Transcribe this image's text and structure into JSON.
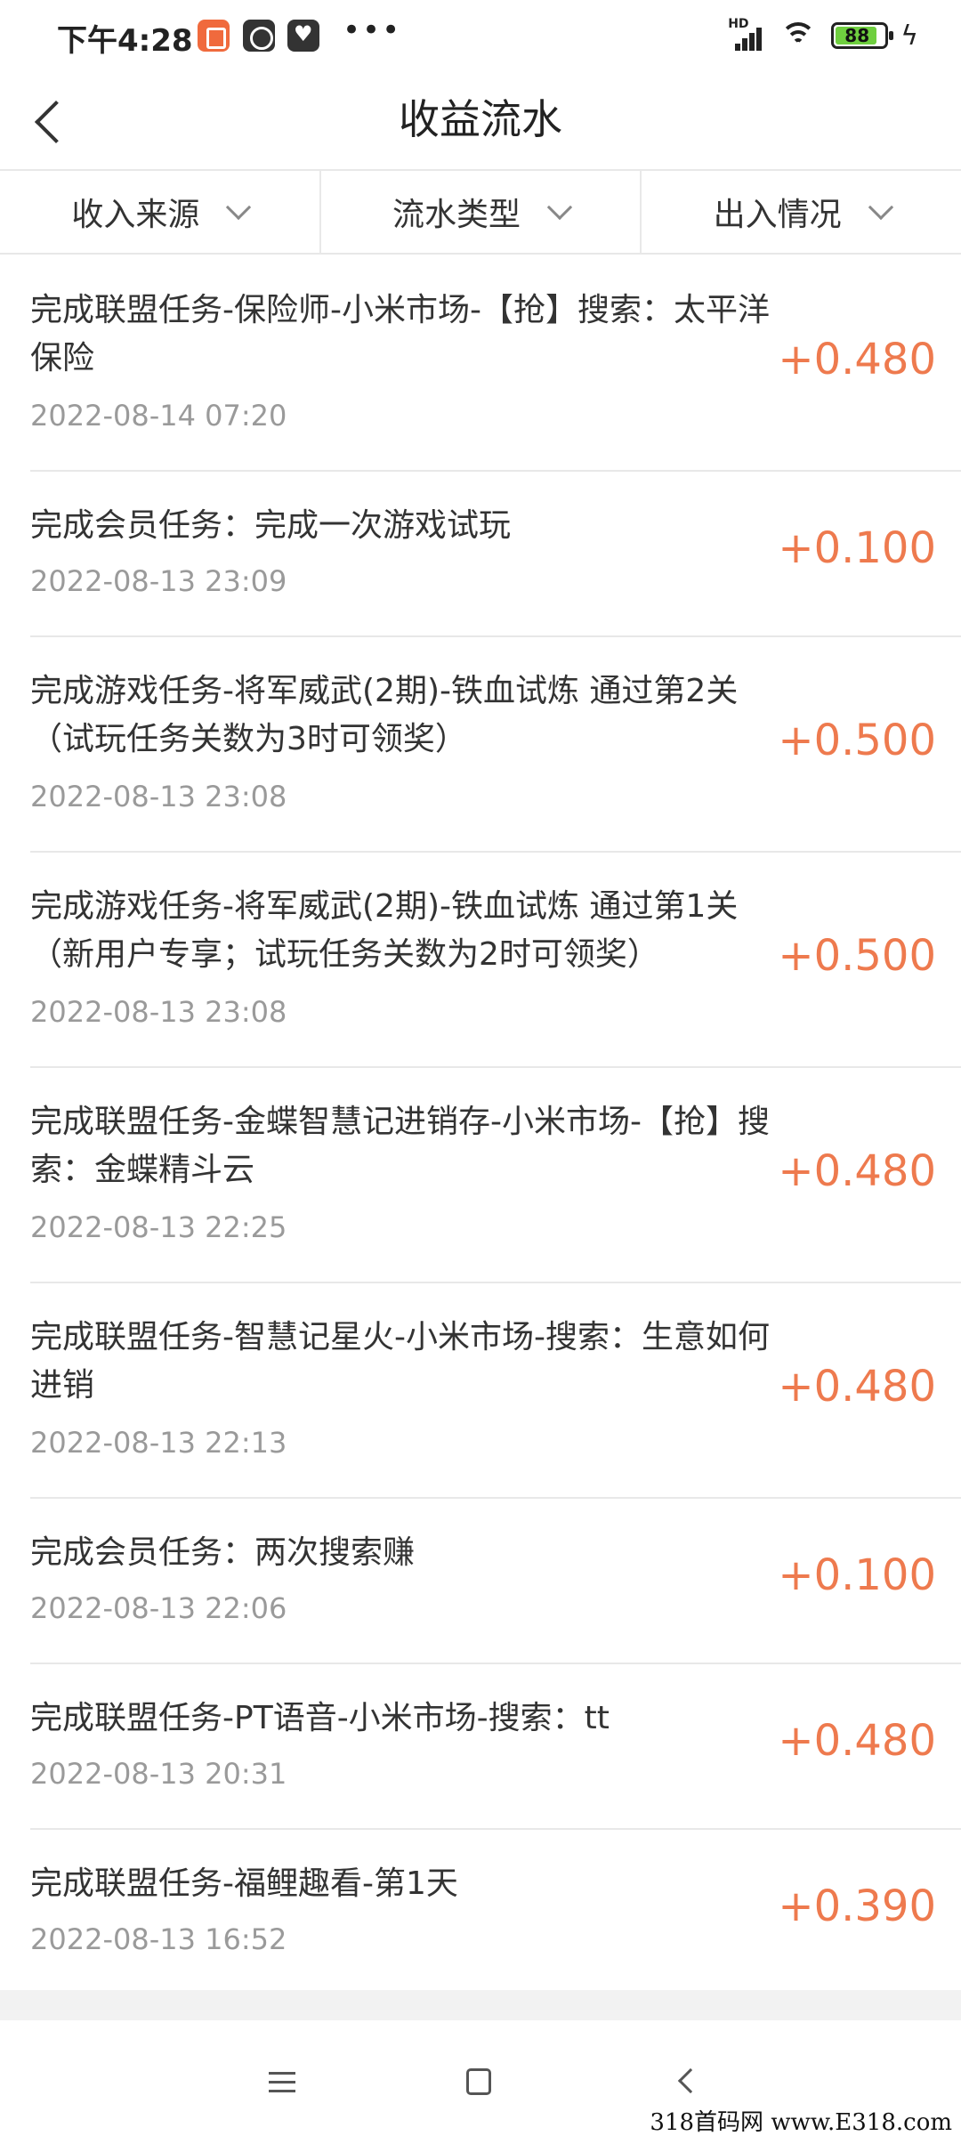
{
  "status_bar": {
    "time": "下午4:28",
    "network": "HD",
    "battery": "88"
  },
  "header": {
    "title": "收益流水",
    "back_icon": "chevron-left-icon"
  },
  "filters": [
    {
      "label": "收入来源"
    },
    {
      "label": "流水类型"
    },
    {
      "label": "出入情况"
    }
  ],
  "records": [
    {
      "title": "完成联盟任务-保险师-小米市场-【抢】搜索：太平洋保险",
      "date": "2022-08-14 07:20",
      "amount": "+0.480"
    },
    {
      "title": "完成会员任务：完成一次游戏试玩",
      "date": "2022-08-13 23:09",
      "amount": "+0.100"
    },
    {
      "title": "完成游戏任务-将军威武(2期)-铁血试炼 通过第2关（试玩任务关数为3时可领奖）",
      "date": "2022-08-13 23:08",
      "amount": "+0.500"
    },
    {
      "title": "完成游戏任务-将军威武(2期)-铁血试炼 通过第1关（新用户专享；试玩任务关数为2时可领奖）",
      "date": "2022-08-13 23:08",
      "amount": "+0.500"
    },
    {
      "title": "完成联盟任务-金蝶智慧记进销存-小米市场-【抢】搜索：金蝶精斗云",
      "date": "2022-08-13 22:25",
      "amount": "+0.480"
    },
    {
      "title": "完成联盟任务-智慧记星火-小米市场-搜索：生意如何进销",
      "date": "2022-08-13 22:13",
      "amount": "+0.480"
    },
    {
      "title": "完成会员任务：两次搜索赚",
      "date": "2022-08-13 22:06",
      "amount": "+0.100"
    },
    {
      "title": "完成联盟任务-PT语音-小米市场-搜索：tt",
      "date": "2022-08-13 20:31",
      "amount": "+0.480"
    },
    {
      "title": "完成联盟任务-福鲤趣看-第1天",
      "date": "2022-08-13 16:52",
      "amount": "+0.390"
    }
  ],
  "watermark": "318首码网 www.E318.com",
  "colors": {
    "amount": "#ee7a4e",
    "date": "#9a9a9a",
    "divider": "#e8e8e8"
  }
}
